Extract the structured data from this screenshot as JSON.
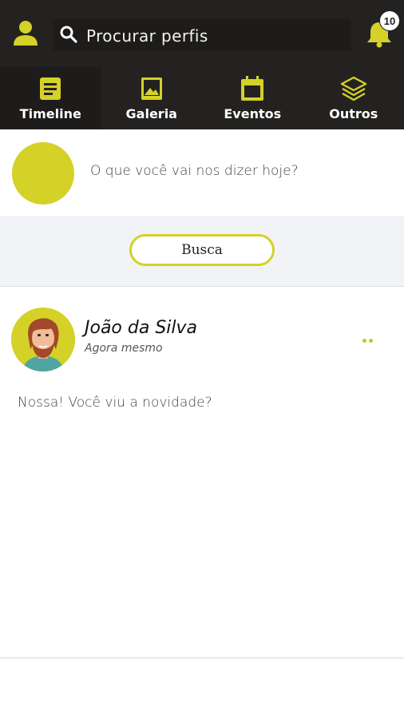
{
  "header": {
    "search_placeholder": "Procurar perfis",
    "notification_count": "10",
    "icons": {
      "profile": "user-icon",
      "search": "search-icon",
      "notifications": "bell-icon"
    }
  },
  "tabs": [
    {
      "label": "Timeline",
      "icon": "document-icon",
      "active": true
    },
    {
      "label": "Galeria",
      "icon": "image-icon",
      "active": false
    },
    {
      "label": "Eventos",
      "icon": "calendar-icon",
      "active": false
    },
    {
      "label": "Outros",
      "icon": "layers-icon",
      "active": false
    }
  ],
  "composer": {
    "prompt": "O que você vai nos dizer hoje?",
    "search_button_label": "Busca"
  },
  "post": {
    "author": "João da Silva",
    "time": "Agora mesmo",
    "text": "Nossa! Você viu a novidade?"
  },
  "colors": {
    "accent": "#d4d128",
    "header_bg": "#242220",
    "band_bg": "#f2f3f6"
  }
}
